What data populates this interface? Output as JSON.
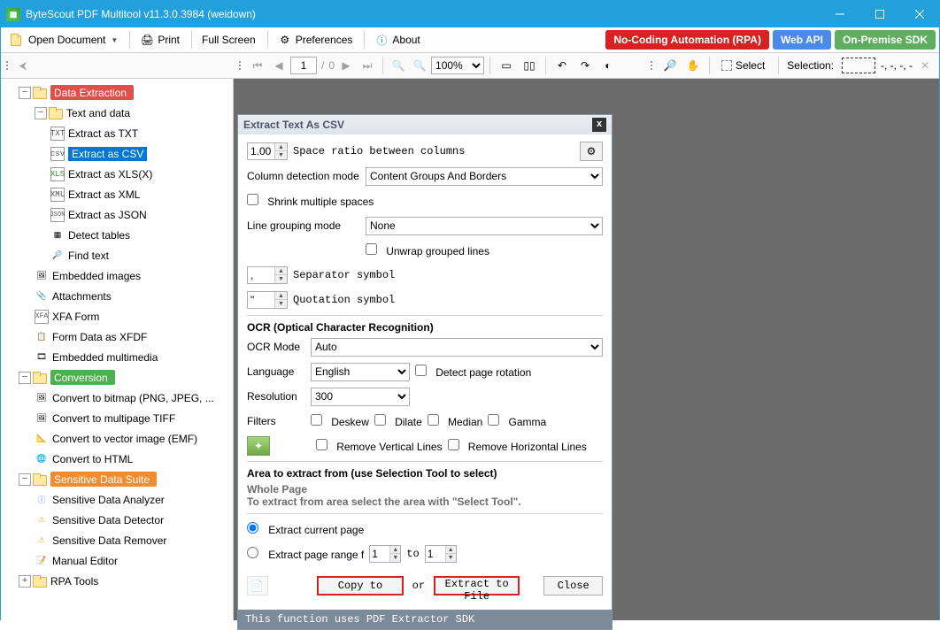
{
  "title": "ByteScout PDF Multitool v11.3.0.3984 (weidown)",
  "toolbar": {
    "open": "Open Document",
    "print": "Print",
    "fullscreen": "Full Screen",
    "prefs": "Preferences",
    "about": "About"
  },
  "pills": {
    "rpa": "No-Coding Automation (RPA)",
    "webapi": "Web API",
    "sdk": "On-Premise SDK"
  },
  "pager": {
    "page": "1",
    "sep": "/",
    "total": "0",
    "zoom": "100%",
    "select_label": "Select",
    "selection_label": "Selection:",
    "selection_value": "-, -, -, -"
  },
  "tree": {
    "data_extraction": "Data Extraction",
    "text_and_data": "Text and data",
    "extract_txt": "Extract as TXT",
    "extract_csv": "Extract as CSV",
    "extract_xls": "Extract as XLS(X)",
    "extract_xml": "Extract as XML",
    "extract_json": "Extract as JSON",
    "detect_tables": "Detect tables",
    "find_text": "Find text",
    "embedded_images": "Embedded images",
    "attachments": "Attachments",
    "xfa_form": "XFA Form",
    "form_data": "Form Data as XFDF",
    "embedded_mm": "Embedded multimedia",
    "conversion": "Conversion",
    "conv_bitmap": "Convert to bitmap (PNG, JPEG, ...",
    "conv_tiff": "Convert to multipage TIFF",
    "conv_vector": "Convert to vector image (EMF)",
    "conv_html": "Convert to HTML",
    "sensitive": "Sensitive Data Suite",
    "sens_analyzer": "Sensitive Data Analyzer",
    "sens_detector": "Sensitive Data Detector",
    "sens_remover": "Sensitive Data Remover",
    "manual_editor": "Manual Editor",
    "rpa_tools": "RPA Tools"
  },
  "panel": {
    "title": "Extract Text As CSV",
    "space_ratio_value": "1.00",
    "space_ratio_label": "Space ratio between columns",
    "col_detect_label": "Column detection mode",
    "col_detect_value": "Content Groups And Borders",
    "shrink": "Shrink multiple spaces",
    "line_group_label": "Line grouping mode",
    "line_group_value": "None",
    "unwrap": "Unwrap grouped lines",
    "sep_value": ",",
    "sep_label": "Separator symbol",
    "quot_value": "\"",
    "quot_label": "Quotation symbol",
    "ocr_heading": "OCR (Optical Character Recognition)",
    "ocr_mode_label": "OCR Mode",
    "ocr_mode_value": "Auto",
    "language_label": "Language",
    "language_value": "English",
    "detect_rotation": "Detect page rotation",
    "resolution_label": "Resolution",
    "resolution_value": "300",
    "filters_label": "Filters",
    "deskew": "Deskew",
    "dilate": "Dilate",
    "median": "Median",
    "gamma": "Gamma",
    "rem_v": "Remove Vertical Lines",
    "rem_h": "Remove Horizontal Lines",
    "area_heading": "Area to extract from (use Selection Tool to select)",
    "whole_page": "Whole Page",
    "area_hint": "To extract from area select the area with \"Select Tool\".",
    "extract_current": "Extract current page",
    "extract_range": "Extract page range f",
    "range_from": "1",
    "range_to_label": "to",
    "range_to": "1",
    "copy_to": "Copy to",
    "or": "or",
    "extract_file": "Extract to File",
    "close": "Close",
    "footer": "This function uses PDF Extractor SDK"
  }
}
